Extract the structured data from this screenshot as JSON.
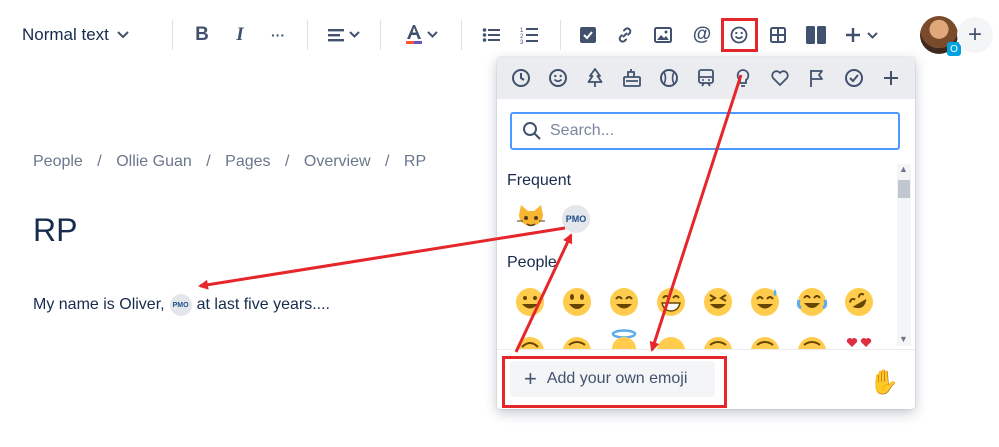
{
  "toolbar": {
    "text_style": "Normal text",
    "bold": "B",
    "italic": "I",
    "more": "···",
    "mention": "@",
    "plus": "+"
  },
  "user": {
    "badge": "O"
  },
  "breadcrumb": [
    "People",
    "/",
    "Ollie Guan",
    "/",
    "Pages",
    "/",
    "Overview",
    "/",
    "RP"
  ],
  "page": {
    "title": "RP",
    "text_before": "My name is Oliver,",
    "text_after": "at last five years....",
    "inline_emoji_label": "PMO"
  },
  "picker": {
    "search_placeholder": "Search...",
    "frequent_label": "Frequent",
    "people_label": "People",
    "custom_emoji_label": "PMO",
    "add_emoji_label": "Add your own emoji",
    "skin_tone": "✋"
  },
  "colors": {
    "accent": "#4c9aff",
    "highlight": "#e5262b",
    "text": "#172b4d"
  }
}
